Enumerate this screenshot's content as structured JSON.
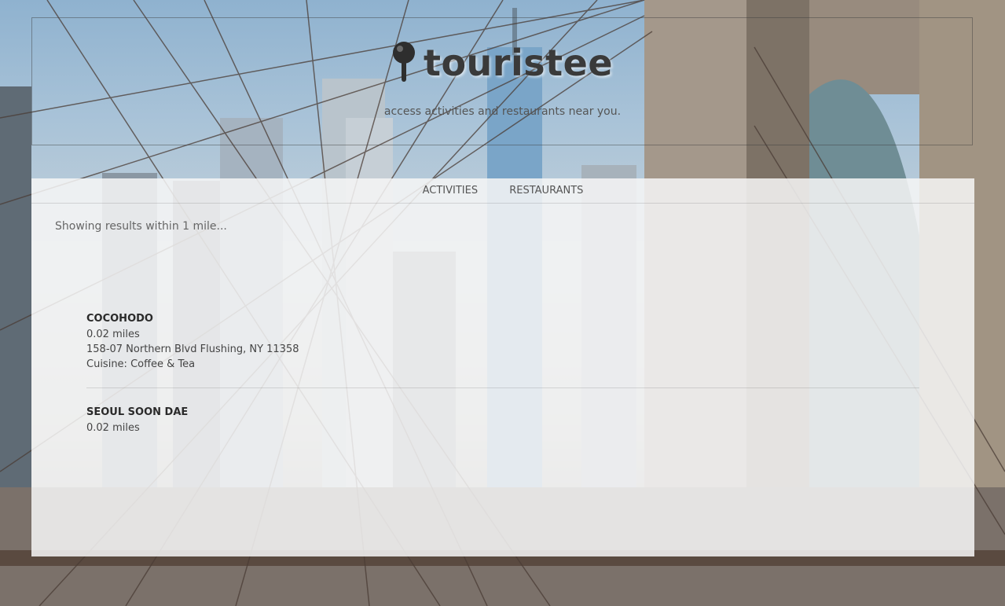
{
  "brand": {
    "name": "touristee",
    "tagline": "access activities and restaurants near you."
  },
  "tabs": [
    {
      "label": "ACTIVITIES"
    },
    {
      "label": "RESTAURANTS"
    }
  ],
  "results": {
    "status": "Showing results within 1 mile...",
    "items": [
      {
        "name": "COCOHODO",
        "distance": "0.02 miles",
        "address": "158-07 Northern Blvd Flushing, NY 11358",
        "cuisine": "Cuisine: Coffee & Tea"
      },
      {
        "name": "SEOUL SOON DAE",
        "distance": "0.02 miles"
      }
    ]
  },
  "colors": {
    "text_dark": "#3a3a3a",
    "panel_bg": "#f6f6f6"
  },
  "icons": {
    "brand": "map-pin-icon"
  }
}
